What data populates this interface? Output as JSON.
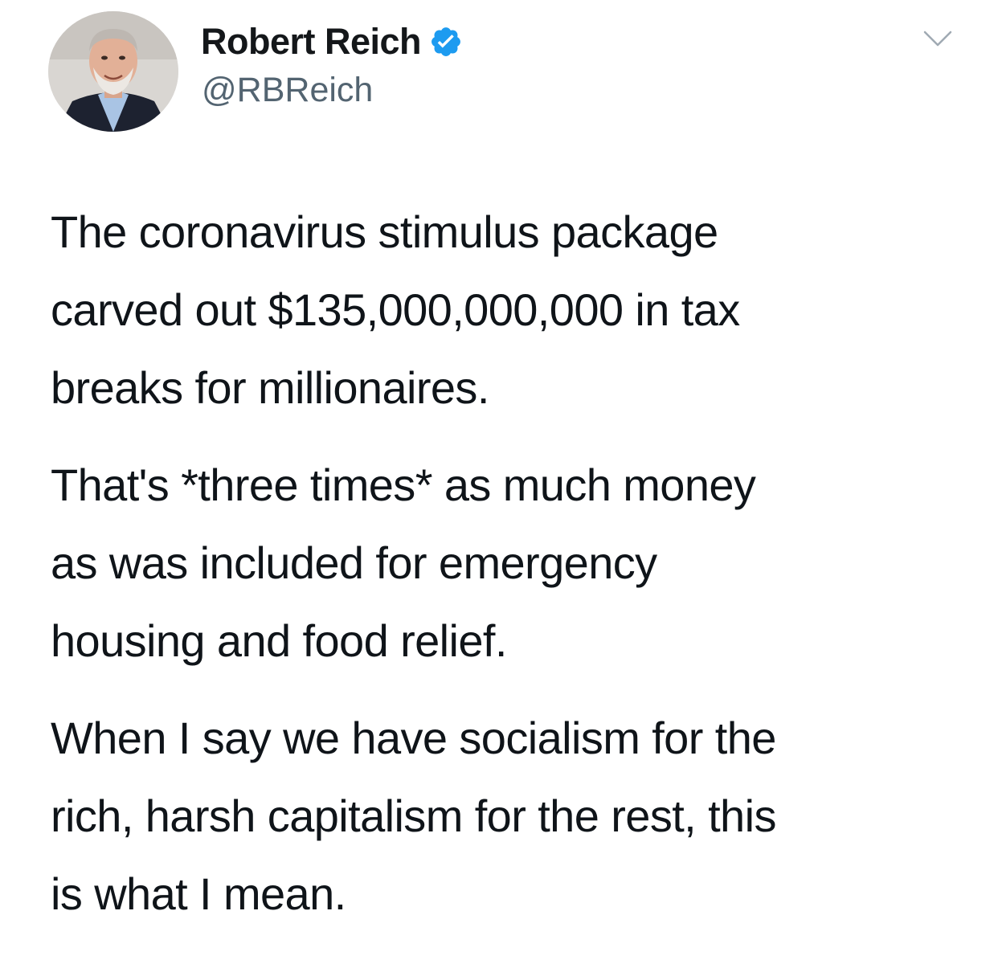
{
  "tweet": {
    "author": {
      "display_name": "Robert Reich",
      "handle": "@RBReich",
      "verified": true,
      "avatar_icon": "profile-photo"
    },
    "menu_icon": "chevron-down-icon",
    "paragraphs": [
      "The coronavirus stimulus package\ncarved out $135,000,000,000 in tax\nbreaks for millionaires.",
      "That's *three times* as much money\nas was included for emergency\nhousing and food relief.",
      "When I say we have socialism for the\nrich, harsh capitalism for the rest, this\nis what I mean."
    ]
  },
  "colors": {
    "verified_badge": "#1d9bf0",
    "text": "#0f1419",
    "secondary_text": "#536471",
    "background": "#ffffff"
  }
}
